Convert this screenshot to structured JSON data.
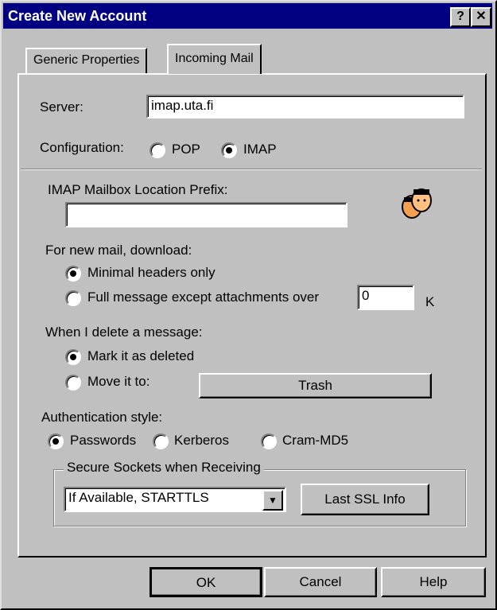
{
  "window": {
    "title": "Create New Account",
    "help_button": "?",
    "close_button": "✕"
  },
  "tabs": [
    {
      "label": "Generic Properties",
      "active": false
    },
    {
      "label": "Incoming Mail",
      "active": true
    }
  ],
  "server": {
    "label": "Server:",
    "value": "imap.uta.fi"
  },
  "configuration": {
    "label": "Configuration:",
    "options": [
      {
        "label": "POP",
        "selected": false
      },
      {
        "label": "IMAP",
        "selected": true
      }
    ]
  },
  "imap_prefix": {
    "label": "IMAP Mailbox Location Prefix:",
    "value": ""
  },
  "new_mail": {
    "label": "For new mail, download:",
    "minimal": {
      "label": "Minimal headers only",
      "selected": true
    },
    "full": {
      "label": "Full message except attachments over",
      "selected": false
    },
    "size_value": "0",
    "size_unit": "K"
  },
  "delete": {
    "label": "When I delete a message:",
    "mark": {
      "label": "Mark it as deleted",
      "selected": true
    },
    "move": {
      "label": "Move it to:",
      "selected": false
    },
    "folder_button": "Trash"
  },
  "auth": {
    "label": "Authentication style:",
    "options": [
      {
        "label": "Passwords",
        "selected": true
      },
      {
        "label": "Kerberos",
        "selected": false
      },
      {
        "label": "Cram-MD5",
        "selected": false
      }
    ]
  },
  "ssl": {
    "group_label": "Secure Sockets when Receiving",
    "select_value": "If Available, STARTTLS",
    "last_info_button": "Last SSL Info"
  },
  "footer": {
    "ok": "OK",
    "cancel": "Cancel",
    "help": "Help"
  },
  "icons": {
    "people": "people-icon",
    "dropdown": "chevron-down-icon"
  }
}
